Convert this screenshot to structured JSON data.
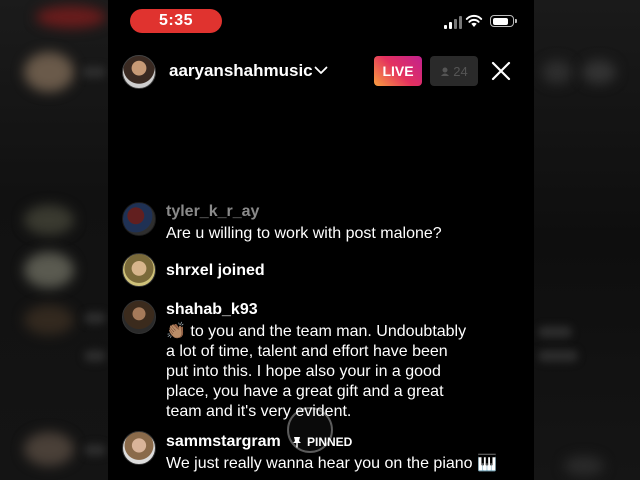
{
  "status_bar": {
    "time": "5:35",
    "time_pill_color": "#e0332f",
    "battery_level": 0.85
  },
  "header": {
    "host_username": "aaryanshahmusic",
    "live_label": "LIVE",
    "viewer_count": "24",
    "live_gradient": [
      "#f9a03f",
      "#e4315f",
      "#c2218f"
    ]
  },
  "comments": [
    {
      "username": "tyler_k_r_ay",
      "text": "Are u willing to work with post malone?",
      "faded": true
    },
    {
      "username": "shrxel joined",
      "text": ""
    },
    {
      "username": "shahab_k93",
      "emoji": "👏🏽",
      "text_lines": [
        "to you and the team man. Undoubtably",
        "a lot of time, talent and effort have been",
        "put into this. I hope also your in a good",
        "place, you have a great gift and a great",
        "team and it's very evident."
      ]
    },
    {
      "username": "sammstargram",
      "pinned_label": "PINNED",
      "text": "We just really wanna hear you on the piano",
      "emoji_trailing": "🎹"
    }
  ],
  "icons": [
    "signal-icon",
    "wifi-icon",
    "battery-icon",
    "chevron-down-icon",
    "eye-icon",
    "close-icon",
    "pin-icon"
  ]
}
